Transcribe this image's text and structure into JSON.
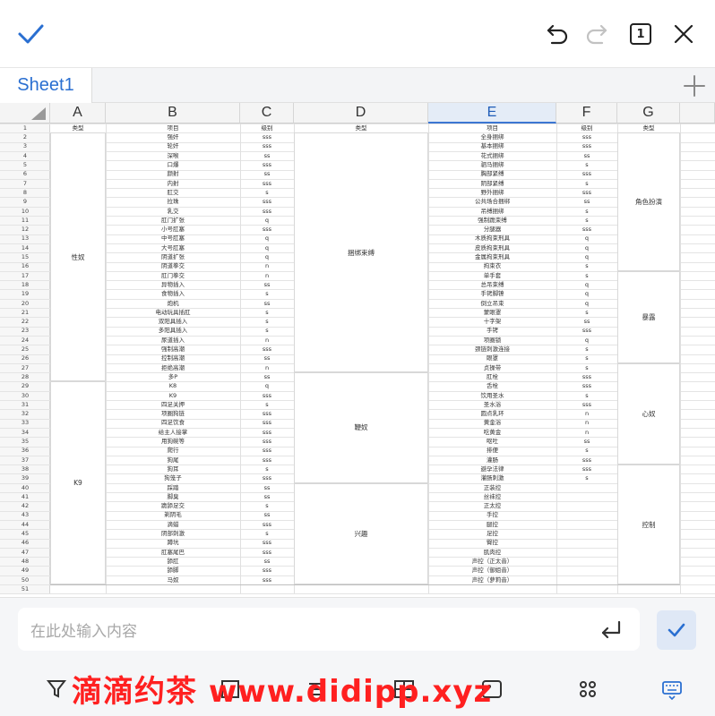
{
  "toolbar_top": {
    "confirm_icon": "checkmark-icon",
    "undo_icon": "undo-icon",
    "redo_icon": "redo-icon",
    "sheet_count": "1",
    "close_icon": "close-icon"
  },
  "tabs": {
    "sheet_name": "Sheet1",
    "add_icon": "plus-icon"
  },
  "columns": [
    "A",
    "B",
    "C",
    "D",
    "E",
    "F",
    "G"
  ],
  "selected_column": "E",
  "rows": [
    {
      "n": "1",
      "b": "项目",
      "c": "级别",
      "e": "项目",
      "f": "级别"
    },
    {
      "n": "2",
      "b": "强奸",
      "c": "sss",
      "e": "全身捆绑",
      "f": "sss"
    },
    {
      "n": "3",
      "b": "轮奸",
      "c": "sss",
      "e": "基本捆绑",
      "f": "sss"
    },
    {
      "n": "4",
      "b": "深喉",
      "c": "ss",
      "e": "花式捆绑",
      "f": "ss"
    },
    {
      "n": "5",
      "b": "口爆",
      "c": "sss",
      "e": "驷马捆绑",
      "f": "s"
    },
    {
      "n": "6",
      "b": "颜射",
      "c": "ss",
      "e": "胸部紧缚",
      "f": "sss"
    },
    {
      "n": "7",
      "b": "内射",
      "c": "sss",
      "e": "阴部紧缚",
      "f": "s"
    },
    {
      "n": "8",
      "b": "肛交",
      "c": "s",
      "e": "野外捆绑",
      "f": "sss"
    },
    {
      "n": "9",
      "b": "拉珠",
      "c": "sss",
      "e": "公共场合捆绑",
      "f": "ss"
    },
    {
      "n": "10",
      "b": "乳交",
      "c": "sss",
      "e": "吊缚捆绑",
      "f": "s"
    },
    {
      "n": "11",
      "b": "肛门扩张",
      "c": "q",
      "e": "强制跪束缚",
      "f": "s"
    },
    {
      "n": "12",
      "b": "小号肛塞",
      "c": "sss",
      "e": "分腿器",
      "f": "sss"
    },
    {
      "n": "13",
      "b": "中号肛塞",
      "c": "q",
      "e": "木质拘束刑具",
      "f": "q"
    },
    {
      "n": "14",
      "b": "大号肛塞",
      "c": "q",
      "e": "皮质拘束刑具",
      "f": "q"
    },
    {
      "n": "15",
      "b": "阴道扩张",
      "c": "q",
      "e": "金属拘束刑具",
      "f": "q"
    },
    {
      "n": "16",
      "b": "阴道拳交",
      "c": "n",
      "e": "拘束衣",
      "f": "s"
    },
    {
      "n": "17",
      "b": "肛门拳交",
      "c": "n",
      "e": "单手套",
      "f": "s"
    },
    {
      "n": "18",
      "b": "异物插入",
      "c": "ss",
      "e": "总吊束缚",
      "f": "q"
    },
    {
      "n": "19",
      "b": "食物插入",
      "c": "s",
      "e": "手铐脚镣",
      "f": "q"
    },
    {
      "n": "20",
      "b": "炮机",
      "c": "ss",
      "e": "倒立吊束",
      "f": "q"
    },
    {
      "n": "21",
      "b": "电动玩具插肛",
      "c": "s",
      "e": "蒙眼罩",
      "f": "s"
    },
    {
      "n": "22",
      "b": "双阳具插入",
      "c": "s",
      "e": "十字架",
      "f": "ss"
    },
    {
      "n": "23",
      "b": "多阳具插入",
      "c": "s",
      "e": "手铐",
      "f": "sss"
    },
    {
      "n": "24",
      "b": "尿道插入",
      "c": "n",
      "e": "项圈锁",
      "f": "q"
    },
    {
      "n": "25",
      "b": "强制高潮",
      "c": "sss",
      "e": "颈链刺激连接",
      "f": "s"
    },
    {
      "n": "26",
      "b": "控制高潮",
      "c": "ss",
      "e": "眼罩",
      "f": "s"
    },
    {
      "n": "27",
      "b": "拒绝高潮",
      "c": "n",
      "e": "贞操带",
      "f": "s"
    },
    {
      "n": "28",
      "b": "多P",
      "c": "ss",
      "e": "肛栓",
      "f": "sss"
    },
    {
      "n": "29",
      "b": "K8",
      "c": "q",
      "e": "舌栓",
      "f": "sss"
    },
    {
      "n": "30",
      "b": "K9",
      "c": "sss",
      "e": "饮用圣水",
      "f": "s"
    },
    {
      "n": "31",
      "b": "四足关押",
      "c": "s",
      "e": "圣水浴",
      "f": "sss"
    },
    {
      "n": "32",
      "b": "项圈狗链",
      "c": "sss",
      "e": "圆点乳环",
      "f": "n"
    },
    {
      "n": "33",
      "b": "四足饮食",
      "c": "sss",
      "e": "黄金浴",
      "f": "n"
    },
    {
      "n": "34",
      "b": "给主人接掌",
      "c": "sss",
      "e": "吃黄金",
      "f": "n"
    },
    {
      "n": "35",
      "b": "用狗碗等",
      "c": "sss",
      "e": "呕吐",
      "f": "ss"
    },
    {
      "n": "36",
      "b": "爬行",
      "c": "sss",
      "e": "排便",
      "f": "s"
    },
    {
      "n": "37",
      "b": "狗尾",
      "c": "sss",
      "e": "灌肠",
      "f": "sss"
    },
    {
      "n": "38",
      "b": "狗耳",
      "c": "s",
      "e": "避孕法律",
      "f": "sss"
    },
    {
      "n": "39",
      "b": "狗笼子",
      "c": "sss",
      "e": "灌肠刺激",
      "f": "s"
    },
    {
      "n": "40",
      "b": "踩踏",
      "c": "ss",
      "e": "正装控",
      "f": ""
    },
    {
      "n": "41",
      "b": "脚臭",
      "c": "ss",
      "e": "丝袜控",
      "f": ""
    },
    {
      "n": "42",
      "b": "跪舔足交",
      "c": "s",
      "e": "正太控",
      "f": ""
    },
    {
      "n": "43",
      "b": "剃阴毛",
      "c": "ss",
      "e": "手控",
      "f": ""
    },
    {
      "n": "44",
      "b": "滴蜡",
      "c": "sss",
      "e": "腿控",
      "f": ""
    },
    {
      "n": "45",
      "b": "阴部刺激",
      "c": "s",
      "e": "足控",
      "f": ""
    },
    {
      "n": "46",
      "b": "蹲坑",
      "c": "sss",
      "e": "臀控",
      "f": ""
    },
    {
      "n": "47",
      "b": "肛塞尾巴",
      "c": "sss",
      "e": "肌肉控",
      "f": ""
    },
    {
      "n": "48",
      "b": "舔肛",
      "c": "ss",
      "e": "声控（正太音）",
      "f": ""
    },
    {
      "n": "49",
      "b": "舔脚",
      "c": "sss",
      "e": "声控（御姐音）",
      "f": ""
    },
    {
      "n": "50",
      "b": "马奴",
      "c": "sss",
      "e": "声控（萝莉音）",
      "f": ""
    },
    {
      "n": "51",
      "b": "",
      "c": "",
      "e": "",
      "f": ""
    }
  ],
  "header_row": {
    "a": "类型",
    "d": "类型",
    "g": "类型"
  },
  "merged_a": [
    "性奴",
    "K9"
  ],
  "merged_d": [
    "捆绑束缚",
    "鞭奴",
    "兴趣"
  ],
  "merged_g": [
    "角色扮演",
    "暴露",
    "心奴",
    "控制"
  ],
  "input": {
    "placeholder": "在此处输入内容",
    "enter_icon": "enter-return-icon",
    "confirm_icon": "checkmark-icon"
  },
  "bottom_toolbar": {
    "icons": [
      "filter-icon",
      "format-icon",
      "list-icon",
      "table-icon",
      "picture-icon",
      "more-icon",
      "keyboard-icon"
    ]
  },
  "watermark": "滴滴约茶 www.didipp.xyz",
  "colors": {
    "accent": "#2a6fd1",
    "watermark": "#ff2020"
  }
}
